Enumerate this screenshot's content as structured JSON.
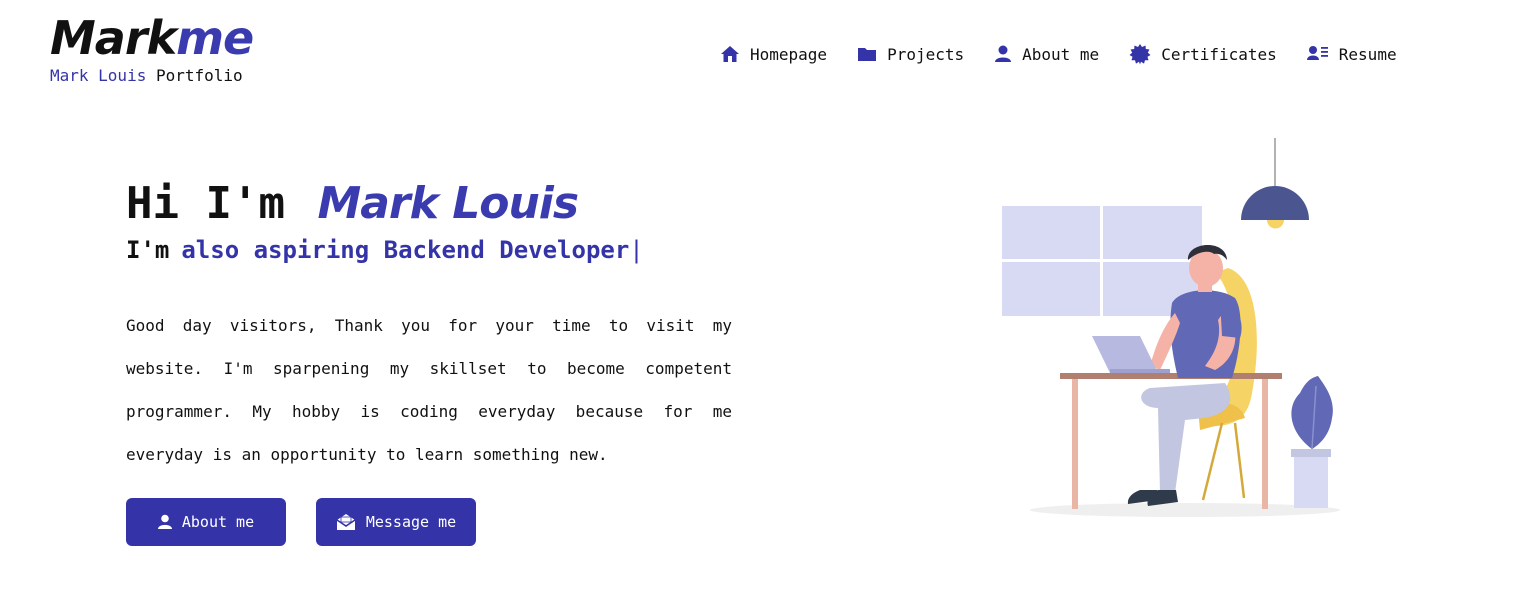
{
  "brand": {
    "logo_main": "Mark",
    "logo_accent": "me",
    "tagline_accent": "Mark Louis",
    "tagline_rest": " Portfolio"
  },
  "nav": {
    "items": [
      {
        "label": "Homepage",
        "icon": "home-icon"
      },
      {
        "label": "Projects",
        "icon": "folder-icon"
      },
      {
        "label": "About me",
        "icon": "user-icon"
      },
      {
        "label": "Certificates",
        "icon": "certificate-icon"
      },
      {
        "label": "Resume",
        "icon": "resume-icon"
      }
    ]
  },
  "hero": {
    "greeting": "Hi I'm",
    "name": "Mark Louis",
    "sub_prefix": "I'm",
    "sub_role": "also aspiring Backend Developer",
    "cursor": "|",
    "description": "Good day visitors, Thank you for your time to visit my website. I'm sparpening my skillset to become competent programmer. My hobby is coding everyday because for me everyday is an opportunity to learn something new."
  },
  "buttons": {
    "about_label": "About me",
    "message_label": "Message me"
  },
  "colors": {
    "accent": "#3434a8",
    "illustration_shirt": "#6168b5",
    "chair": "#f6d365",
    "window": "#d8d9f2"
  }
}
